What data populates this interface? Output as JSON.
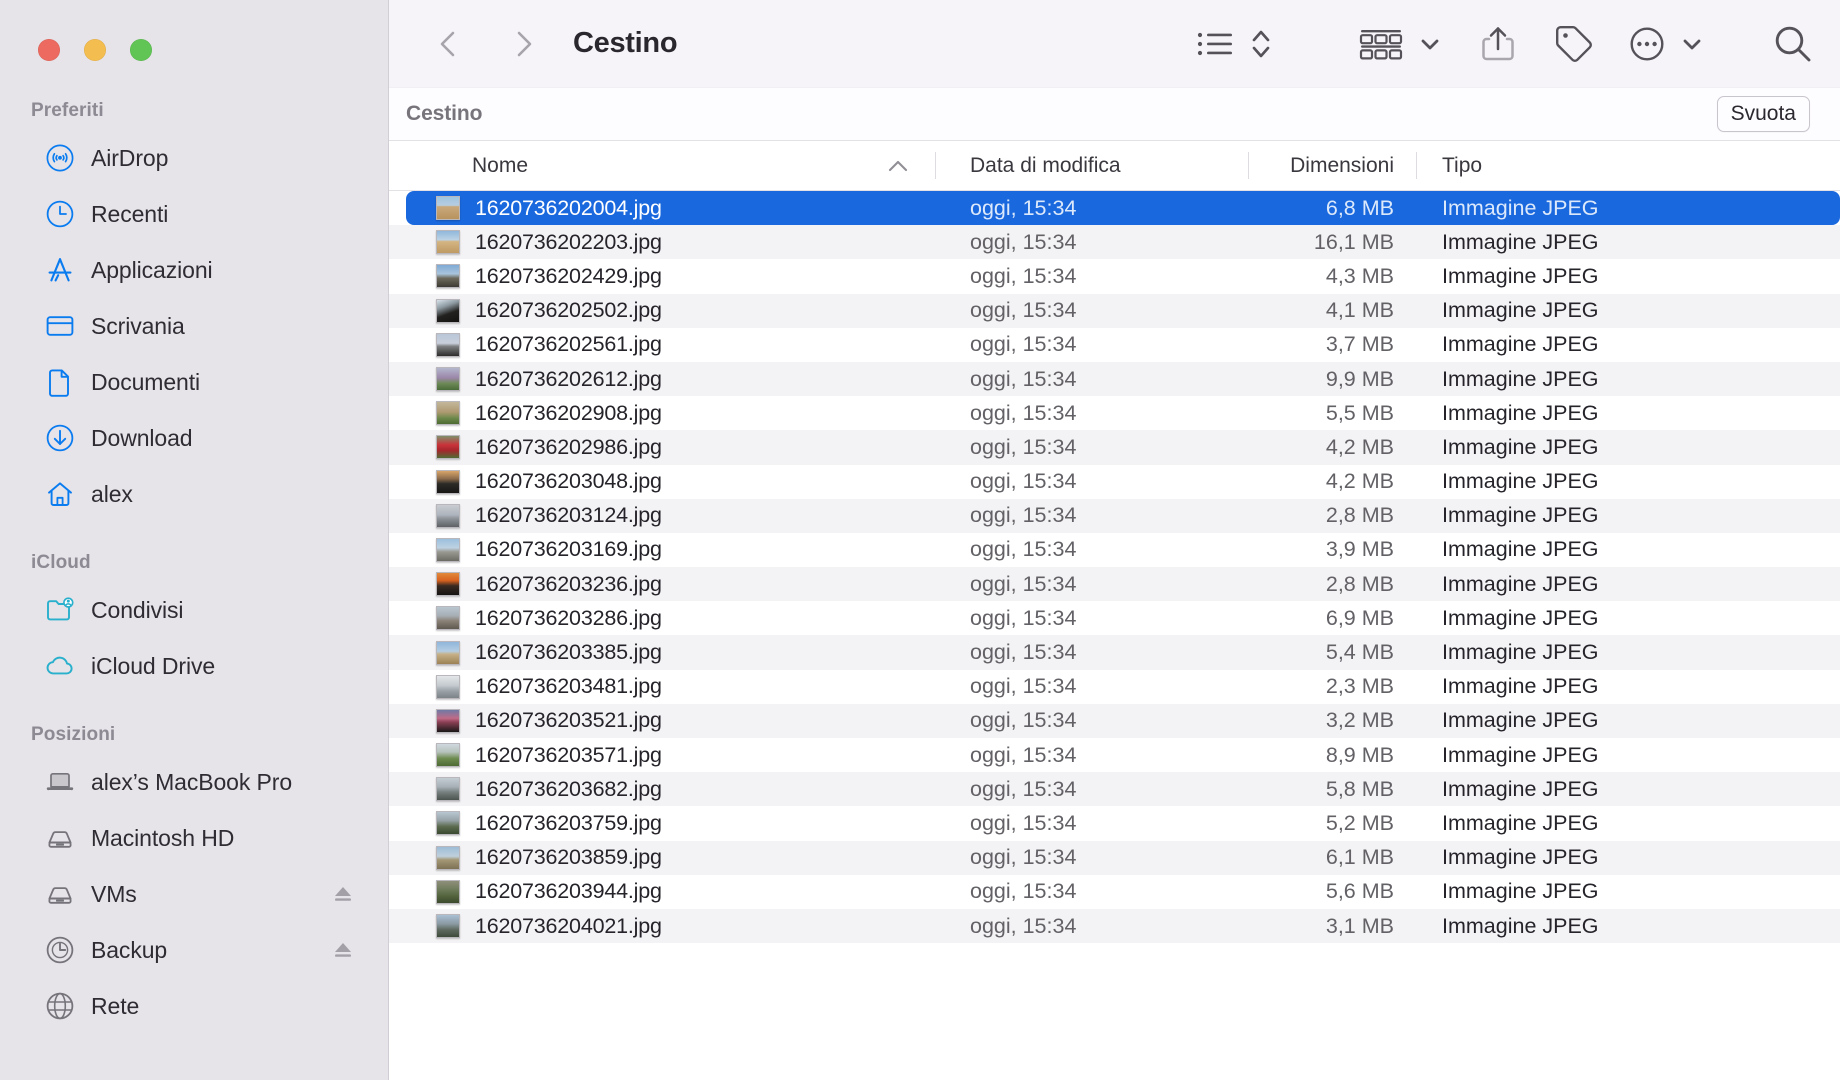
{
  "window": {
    "title": "Cestino",
    "traffic_lights": [
      "close",
      "minimize",
      "zoom"
    ]
  },
  "toolbar": {
    "back_icon": "chevron-left-icon",
    "forward_icon": "chevron-right-icon",
    "view_list_icon": "list-view-icon",
    "view_sort_icon": "sort-updown-icon",
    "group_icon": "group-by-icon",
    "group_chevron_icon": "chevron-down-icon",
    "share_icon": "share-icon",
    "tag_icon": "tag-icon",
    "more_icon": "ellipsis-circle-icon",
    "more_chevron_icon": "chevron-down-icon",
    "search_icon": "search-icon"
  },
  "pathbar": {
    "label": "Cestino",
    "empty_button": "Svuota"
  },
  "sidebar": {
    "groups": [
      {
        "title": "Preferiti",
        "items": [
          {
            "label": "AirDrop",
            "icon": "airdrop-icon",
            "color": "#0a7cf0",
            "eject": false
          },
          {
            "label": "Recenti",
            "icon": "clock-icon",
            "color": "#0a7cf0",
            "eject": false
          },
          {
            "label": "Applicazioni",
            "icon": "applications-icon",
            "color": "#0a7cf0",
            "eject": false
          },
          {
            "label": "Scrivania",
            "icon": "desktop-icon",
            "color": "#0a7cf0",
            "eject": false
          },
          {
            "label": "Documenti",
            "icon": "document-icon",
            "color": "#0a7cf0",
            "eject": false
          },
          {
            "label": "Download",
            "icon": "download-icon",
            "color": "#0a7cf0",
            "eject": false
          },
          {
            "label": "alex",
            "icon": "home-icon",
            "color": "#0a7cf0",
            "eject": false
          }
        ]
      },
      {
        "title": "iCloud",
        "items": [
          {
            "label": "Condivisi",
            "icon": "shared-folder-icon",
            "color": "#29b0cc",
            "eject": false
          },
          {
            "label": "iCloud Drive",
            "icon": "cloud-icon",
            "color": "#29b0cc",
            "eject": false
          }
        ]
      },
      {
        "title": "Posizioni",
        "items": [
          {
            "label": "alex’s MacBook Pro",
            "icon": "laptop-icon",
            "color": "#76747b",
            "eject": false
          },
          {
            "label": "Macintosh HD",
            "icon": "harddisk-icon",
            "color": "#76747b",
            "eject": false
          },
          {
            "label": "VMs",
            "icon": "harddisk-icon",
            "color": "#76747b",
            "eject": true
          },
          {
            "label": "Backup",
            "icon": "timemachine-icon",
            "color": "#76747b",
            "eject": true
          },
          {
            "label": "Rete",
            "icon": "globe-icon",
            "color": "#76747b",
            "eject": false
          }
        ]
      }
    ]
  },
  "columns": {
    "name": "Nome",
    "date": "Data di modifica",
    "size": "Dimensioni",
    "kind": "Tipo",
    "sort_by": "name",
    "sort_direction": "ascending"
  },
  "files": [
    {
      "name": "1620736202004.jpg",
      "date": "oggi, 15:34",
      "size": "6,8 MB",
      "kind": "Immagine JPEG",
      "selected": true,
      "thumb": "linear-gradient(180deg,#9fc4e0 0%,#b7cde0 38%,#c9a87a 44%,#b8935f 100%)"
    },
    {
      "name": "1620736202203.jpg",
      "date": "oggi, 15:34",
      "size": "16,1 MB",
      "kind": "Immagine JPEG",
      "selected": false,
      "thumb": "linear-gradient(180deg,#8fb8dc 0%,#bcd2e4 40%,#d3b482 48%,#bf9a63 100%)"
    },
    {
      "name": "1620736202429.jpg",
      "date": "oggi, 15:34",
      "size": "4,3 MB",
      "kind": "Immagine JPEG",
      "selected": false,
      "thumb": "linear-gradient(180deg,#7ea9d4 0%,#a9c4dc 40%,#6d6a5c 60%,#3c3a34 100%)"
    },
    {
      "name": "1620736202502.jpg",
      "date": "oggi, 15:34",
      "size": "4,1 MB",
      "kind": "Immagine JPEG",
      "selected": false,
      "thumb": "linear-gradient(160deg,#d7e2ea 0%,#8e9aa2 30%,#22211f 60%,#141312 100%)"
    },
    {
      "name": "1620736202561.jpg",
      "date": "oggi, 15:34",
      "size": "3,7 MB",
      "kind": "Immagine JPEG",
      "selected": false,
      "thumb": "linear-gradient(180deg,#b9c6d8 0%,#c9cfdb 42%,#7d7f80 56%,#2e2d2c 100%)"
    },
    {
      "name": "1620736202612.jpg",
      "date": "oggi, 15:34",
      "size": "9,9 MB",
      "kind": "Immagine JPEG",
      "selected": false,
      "thumb": "linear-gradient(180deg,#b3b6cd 0%,#9b86a8 45%,#6d8a56 70%,#4a6b3a 100%)"
    },
    {
      "name": "1620736202908.jpg",
      "date": "oggi, 15:34",
      "size": "5,5 MB",
      "kind": "Immagine JPEG",
      "selected": false,
      "thumb": "linear-gradient(180deg,#c2b79a 0%,#b09a72 45%,#6f8a4c 72%,#4d6b33 100%)"
    },
    {
      "name": "1620736202986.jpg",
      "date": "oggi, 15:34",
      "size": "4,2 MB",
      "kind": "Immagine JPEG",
      "selected": false,
      "thumb": "linear-gradient(180deg,#7f8f6b 0%,#c8333a 40%,#a8252c 65%,#4e6b33 100%)"
    },
    {
      "name": "1620736203048.jpg",
      "date": "oggi, 15:34",
      "size": "4,2 MB",
      "kind": "Immagine JPEG",
      "selected": false,
      "thumb": "linear-gradient(180deg,#d8a56a 0%,#8a6a4a 36%,#2c2b28 58%,#171614 100%)"
    },
    {
      "name": "1620736203124.jpg",
      "date": "oggi, 15:34",
      "size": "2,8 MB",
      "kind": "Immagine JPEG",
      "selected": false,
      "thumb": "linear-gradient(180deg,#c9ccd2 0%,#aeb4bd 45%,#8d9298 62%,#5d6166 100%)"
    },
    {
      "name": "1620736203169.jpg",
      "date": "oggi, 15:34",
      "size": "3,9 MB",
      "kind": "Immagine JPEG",
      "selected": false,
      "thumb": "linear-gradient(180deg,#9cc0de 0%,#bdd2e2 40%,#9a9a92 58%,#6b6b63 100%)"
    },
    {
      "name": "1620736203236.jpg",
      "date": "oggi, 15:34",
      "size": "2,8 MB",
      "kind": "Immagine JPEG",
      "selected": false,
      "thumb": "linear-gradient(180deg,#e08a3c 0%,#d9621f 34%,#3a2a22 58%,#151413 100%)"
    },
    {
      "name": "1620736203286.jpg",
      "date": "oggi, 15:34",
      "size": "6,9 MB",
      "kind": "Immagine JPEG",
      "selected": false,
      "thumb": "linear-gradient(180deg,#b9c6d0 0%,#a6aeb4 40%,#8c8378 62%,#5f5950 100%)"
    },
    {
      "name": "1620736203385.jpg",
      "date": "oggi, 15:34",
      "size": "5,4 MB",
      "kind": "Immagine JPEG",
      "selected": false,
      "thumb": "linear-gradient(180deg,#8fb6db 0%,#b4cde2 42%,#c7b086 56%,#9c8156 100%)"
    },
    {
      "name": "1620736203481.jpg",
      "date": "oggi, 15:34",
      "size": "2,3 MB",
      "kind": "Immagine JPEG",
      "selected": false,
      "thumb": "linear-gradient(180deg,#e3e6e8 0%,#c5cbd0 42%,#9aa2a8 68%,#7c8489 100%)"
    },
    {
      "name": "1620736203521.jpg",
      "date": "oggi, 15:34",
      "size": "3,2 MB",
      "kind": "Immagine JPEG",
      "selected": false,
      "thumb": "linear-gradient(180deg,#6f7aa6 0%,#c06a86 38%,#8a3f55 55%,#191818 100%)"
    },
    {
      "name": "1620736203571.jpg",
      "date": "oggi, 15:34",
      "size": "8,9 MB",
      "kind": "Immagine JPEG",
      "selected": false,
      "thumb": "linear-gradient(180deg,#cfd8de 0%,#b7c3bd 36%,#6d8a4e 66%,#4e6b35 100%)"
    },
    {
      "name": "1620736203682.jpg",
      "date": "oggi, 15:34",
      "size": "5,8 MB",
      "kind": "Immagine JPEG",
      "selected": false,
      "thumb": "linear-gradient(180deg,#c5cdd4 0%,#a7b0b6 40%,#77807f 64%,#4c534f 100%)"
    },
    {
      "name": "1620736203759.jpg",
      "date": "oggi, 15:34",
      "size": "5,2 MB",
      "kind": "Immagine JPEG",
      "selected": false,
      "thumb": "linear-gradient(180deg,#b8c6d2 0%,#97a3a8 38%,#5c6b4e 66%,#3a4a30 100%)"
    },
    {
      "name": "1620736203859.jpg",
      "date": "oggi, 15:34",
      "size": "6,1 MB",
      "kind": "Immagine JPEG",
      "selected": false,
      "thumb": "linear-gradient(180deg,#9dbcd6 0%,#bfd0dc 42%,#a49877 58%,#7d7254 100%)"
    },
    {
      "name": "1620736203944.jpg",
      "date": "oggi, 15:34",
      "size": "5,6 MB",
      "kind": "Immagine JPEG",
      "selected": false,
      "thumb": "linear-gradient(180deg,#8f8f7a 0%,#6d7a5a 40%,#55663f 66%,#3b4a2c 100%)"
    },
    {
      "name": "1620736204021.jpg",
      "date": "oggi, 15:34",
      "size": "3,1 MB",
      "kind": "Immagine JPEG",
      "selected": false,
      "thumb": "linear-gradient(180deg,#a9c0d4 0%,#8b9aa4 40%,#5f6b60 66%,#3e4a3a 100%)"
    }
  ]
}
